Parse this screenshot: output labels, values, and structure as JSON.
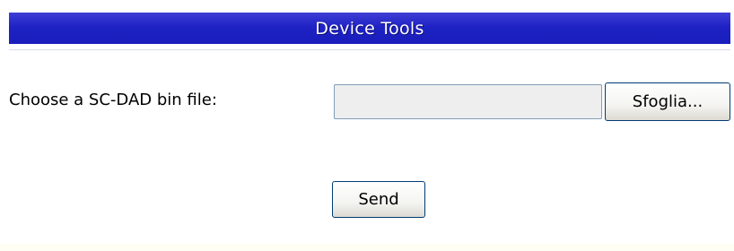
{
  "header": {
    "title": "Device Tools"
  },
  "upload_form": {
    "file_label": "Choose a SC-DAD bin file:",
    "file_value": "",
    "browse_label": "Sfoglia...",
    "send_label": "Send"
  },
  "colors": {
    "header_background": "#2024c4",
    "header_text": "#ffffff",
    "input_background": "#eeeeee",
    "button_border": "#003c74"
  }
}
